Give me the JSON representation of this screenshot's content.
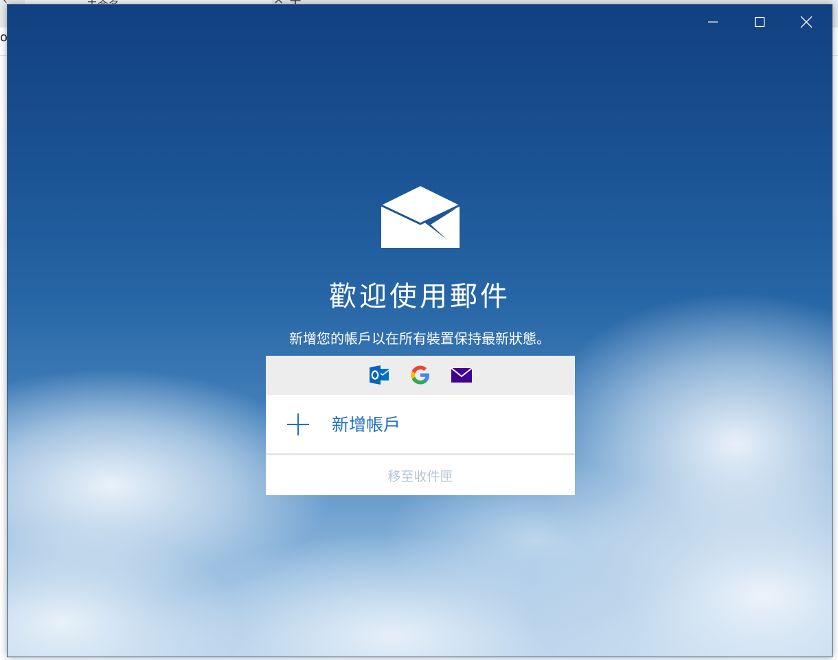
{
  "background_browser": {
    "tab_title": "未命名",
    "address_fragment": "o"
  },
  "window_controls": {
    "minimize": "minimize",
    "maximize": "maximize",
    "close": "close"
  },
  "welcome": {
    "title": "歡迎使用郵件",
    "subtitle": "新增您的帳戶以在所有裝置保持最新狀態。"
  },
  "account_card": {
    "providers": [
      {
        "name": "Outlook",
        "icon": "outlook-icon",
        "color": "#0072c6"
      },
      {
        "name": "Google",
        "icon": "google-icon",
        "color": "#4285f4"
      },
      {
        "name": "Yahoo",
        "icon": "yahoo-mail-icon",
        "color": "#410093"
      }
    ],
    "add_account_label": "新增帳戶",
    "goto_inbox_label": "移至收件匣"
  },
  "colors": {
    "accent": "#1f6fbf",
    "disabled_text": "#b5c6d8",
    "provider_strip": "#ededed"
  }
}
